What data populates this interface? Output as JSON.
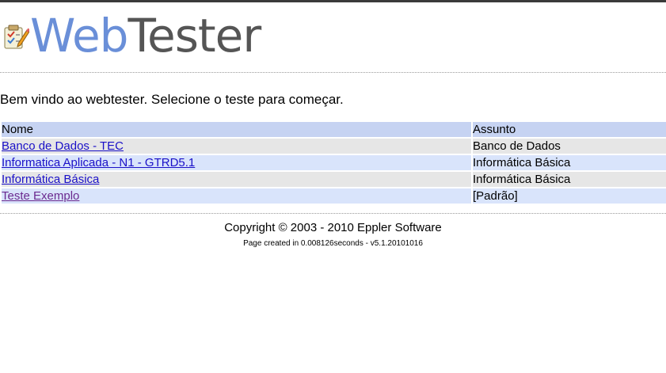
{
  "logo": {
    "word1": "Web",
    "word2": "Tester",
    "icon": "notepad-pencil-icon"
  },
  "welcome_text": "Bem vindo ao webtester. Selecione o teste para começar.",
  "table": {
    "headers": [
      "Nome",
      "Assunto"
    ],
    "rows": [
      {
        "name": "Banco de Dados - TEC",
        "subject": "Banco de Dados",
        "visited": false
      },
      {
        "name": "Informatica Aplicada - N1 - GTRD5.1",
        "subject": "Informática Básica",
        "visited": false
      },
      {
        "name": "Informática Básica",
        "subject": "Informática Básica",
        "visited": false
      },
      {
        "name": "Teste Exemplo",
        "subject": "[Padrão]",
        "visited": true
      }
    ]
  },
  "footer": {
    "copyright": "Copyright © 2003 - 2010 Eppler Software",
    "page_created": "Page created in 0.008126seconds - v5.1.20101016"
  },
  "colors": {
    "header_row": "#c6d3f2",
    "odd_row": "#e6e6e6",
    "even_row": "#d9e4fb",
    "link": "#1a10c8",
    "visited_link": "#6b2a8f",
    "logo_web": "#6a8fd8",
    "logo_tester": "#555555"
  }
}
